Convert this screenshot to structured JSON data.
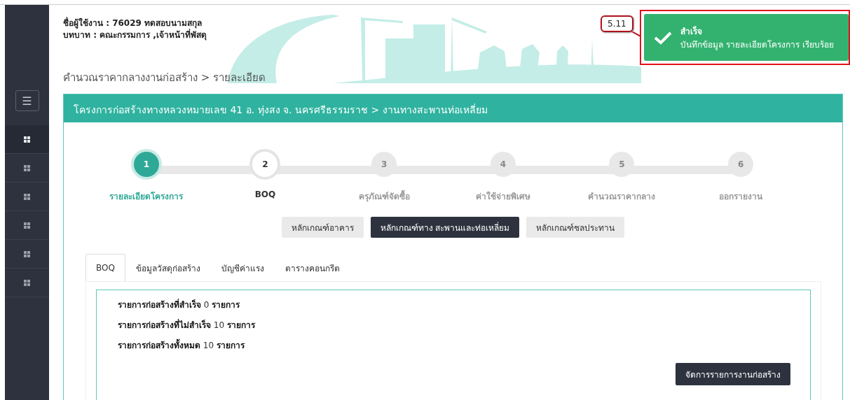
{
  "sidebar": {
    "menu_icon": "☰",
    "items": [
      {
        "selected": true
      },
      {
        "selected": false
      },
      {
        "selected": false
      },
      {
        "selected": false
      },
      {
        "selected": false
      },
      {
        "selected": false
      }
    ]
  },
  "header": {
    "user": "ชื่อผู้ใช้งาน : 76029 ทดสอบนามสกุล",
    "role": "บทบาท :  คณะกรรมการ ,เจ้าหน้าที่พัสดุ",
    "breadcrumb": "คำนวณราคากลางงานก่อสร้าง > รายละเอียด"
  },
  "toast": {
    "title": "สำเร็จ",
    "message": "บันทึกข้อมูล รายละเอียดโครงการ เรียบร้อย",
    "callout": "5.11"
  },
  "panel": {
    "title": "โครงการก่อสร้างทางหลวงหมายเลข 41 อ. ทุ่งสง จ. นครศรีธรรมราช > งานทางสะพานท่อเหลี่ยม",
    "steps": [
      {
        "number": "1",
        "label": "รายละเอียดโครงการ",
        "completed": true,
        "selected": false
      },
      {
        "number": "2",
        "label": "BOQ",
        "completed": false,
        "selected": true
      },
      {
        "number": "3",
        "label": "ครุภัณฑ์จัดซื้อ",
        "completed": false,
        "selected": false
      },
      {
        "number": "4",
        "label": "ค่าใช้จ่ายพิเศษ",
        "completed": false,
        "selected": false
      },
      {
        "number": "5",
        "label": "คำนวณราคากลาง",
        "completed": false,
        "selected": false
      },
      {
        "number": "6",
        "label": "ออกรายงาน",
        "completed": false,
        "selected": false
      }
    ],
    "criteria": [
      {
        "label": "หลักเกณฑ์อาคาร",
        "selected": false
      },
      {
        "label": "หลักเกณฑ์ทาง สะพานและท่อเหลี่ยม",
        "selected": true
      },
      {
        "label": "หลักเกณฑ์ชลประทาน",
        "selected": false
      }
    ],
    "tabs": [
      {
        "label": "BOQ",
        "selected": true
      },
      {
        "label": "ข้อมูลวัสดุก่อสร้าง",
        "selected": false
      },
      {
        "label": "บัญชีค่าแรง",
        "selected": false
      },
      {
        "label": "ตารางคอนกรีต",
        "selected": false
      }
    ],
    "summary": [
      "**รายการก่อสร้างที่สำเร็จ** 0 **รายการ**",
      "**รายการก่อสร้างที่ไม่สำเร็จ** 10 **รายการ**",
      "**รายการก่อสร้างทั้งหมด** 10 **รายการ**"
    ],
    "manage_button": "จัดการรายการงานก่อสร้าง"
  }
}
